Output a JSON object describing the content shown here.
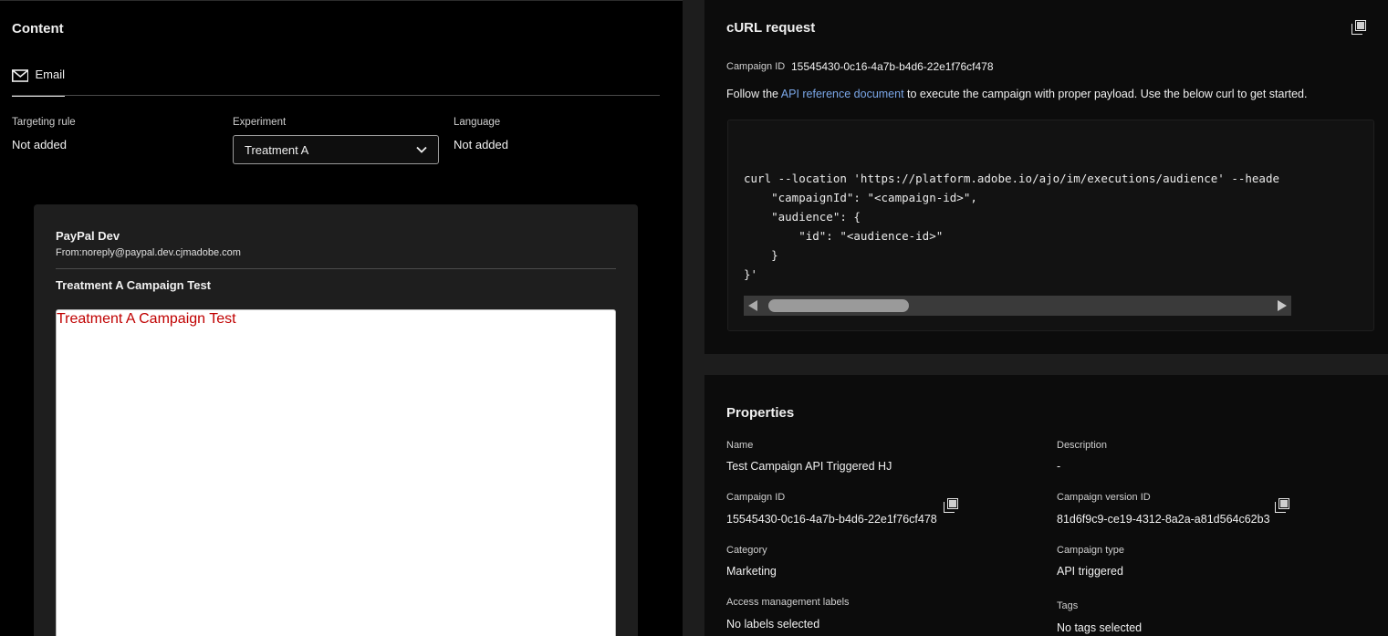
{
  "content": {
    "title": "Content",
    "tab_email": "Email",
    "targeting_rule": {
      "label": "Targeting rule",
      "value": "Not added"
    },
    "experiment": {
      "label": "Experiment",
      "value": "Treatment A"
    },
    "language": {
      "label": "Language",
      "value": "Not added"
    },
    "preview": {
      "sender": "PayPal Dev",
      "from": "From:noreply@paypal.dev.cjmadobe.com",
      "subject": "Treatment A Campaign Test",
      "body_text": "Treatment A Campaign Test"
    }
  },
  "curl": {
    "title": "cURL request",
    "campaign_id_label": "Campaign ID",
    "campaign_id": "15545430-0c16-4a7b-b4d6-22e1f76cf478",
    "instr_pre": "Follow the ",
    "instr_link": "API reference document",
    "instr_post": " to execute the campaign with proper payload. Use the below curl to get started.",
    "code_lines": [
      "curl --location 'https://platform.adobe.io/ajo/im/executions/audience' --heade",
      "    \"campaignId\": \"<campaign-id>\",",
      "    \"audience\": {",
      "        \"id\": \"<audience-id>\"",
      "    }",
      "}'"
    ]
  },
  "properties": {
    "title": "Properties",
    "name": {
      "label": "Name",
      "value": "Test Campaign API Triggered HJ"
    },
    "description": {
      "label": "Description",
      "value": "-"
    },
    "campaign_id": {
      "label": "Campaign ID",
      "value": "15545430-0c16-4a7b-b4d6-22e1f76cf478"
    },
    "campaign_version_id": {
      "label": "Campaign version ID",
      "value": "81d6f9c9-ce19-4312-8a2a-a81d564c62b3"
    },
    "category": {
      "label": "Category",
      "value": "Marketing"
    },
    "campaign_type": {
      "label": "Campaign type",
      "value": "API triggered"
    },
    "access_labels": {
      "label": "Access management labels",
      "value": "No labels selected"
    },
    "tags": {
      "label": "Tags",
      "value": "No tags selected"
    }
  },
  "colors": {
    "background": "#000000",
    "card": "#0c0c0c",
    "link": "#7ba7e8",
    "preview_text": "#c00000"
  },
  "icons": [
    "mail-icon",
    "chevron-down-icon",
    "copy-icon",
    "scroll-left-arrow-icon",
    "scroll-right-arrow-icon"
  ]
}
